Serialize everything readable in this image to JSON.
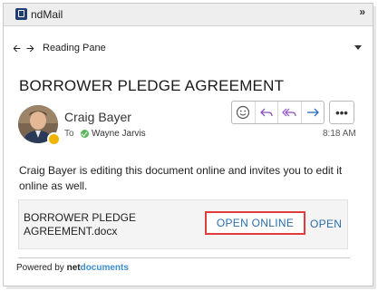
{
  "app": {
    "title": "ndMail",
    "icon": "netdocuments-icon"
  },
  "nav": {
    "label": "Reading Pane"
  },
  "email": {
    "subject": "BORROWER PLEDGE AGREEMENT",
    "sender": "Craig Bayer",
    "to_label": "To",
    "recipient": "Wayne Jarvis",
    "time": "8:18 AM",
    "message": "Craig Bayer is editing this document online and invites you to edit it online as well."
  },
  "actions": {
    "emoji": "smiley-icon",
    "reply": "reply-icon",
    "reply_all": "reply-all-icon",
    "forward": "forward-icon",
    "more": "•••"
  },
  "attachment": {
    "file_line1": "BORROWER PLEDGE",
    "file_line2": "AGREEMENT.docx",
    "open_online": "OPEN ONLINE",
    "open": "OPEN"
  },
  "footer": {
    "prefix": "Powered by ",
    "brand_part1": "net",
    "brand_part2": "documents"
  },
  "colors": {
    "accent": "#2b6cb0",
    "action_icon": "#8a4fbf",
    "highlight_border": "#e03c3c",
    "presence": "#5cb85c"
  }
}
